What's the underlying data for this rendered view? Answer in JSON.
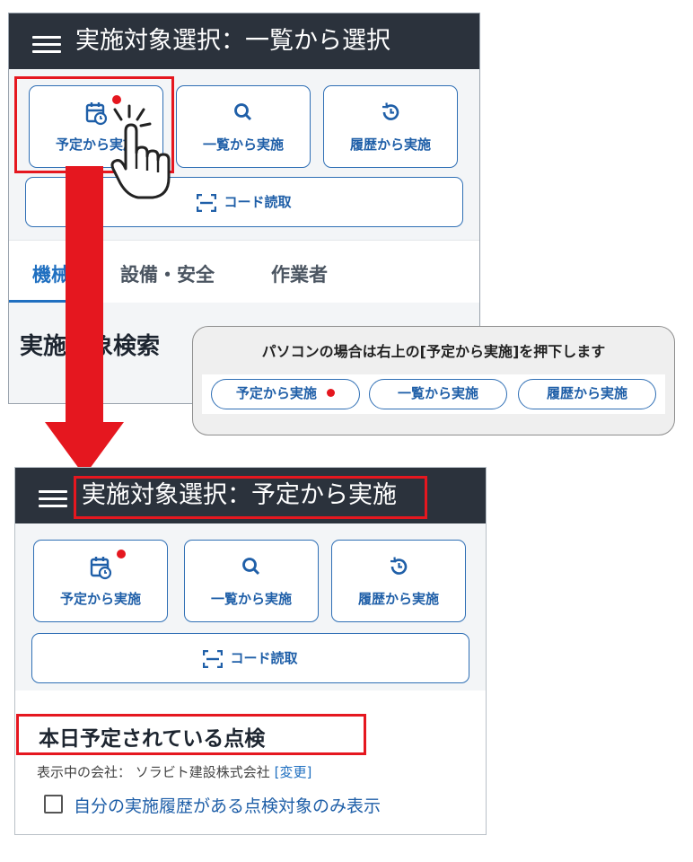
{
  "colors": {
    "header": "#2b323c",
    "accent": "#1f5fa8",
    "highlight": "#e5171f"
  },
  "top_screen": {
    "title": "実施対象選択：一覧から選択",
    "buttons": [
      {
        "label": "予定から実施",
        "icon": "calendar-icon",
        "has_notification_dot": true
      },
      {
        "label": "一覧から実施",
        "icon": "search-icon"
      },
      {
        "label": "履歴から実施",
        "icon": "history-icon"
      }
    ],
    "code_button": "コード読取",
    "tabs": [
      "機械",
      "設備・安全",
      "作業者"
    ],
    "search_title": "実施対象検索"
  },
  "popup": {
    "text": "パソコンの場合は右上の[予定から実施]を押下します",
    "pills": [
      "予定から実施",
      "一覧から実施",
      "履歴から実施"
    ]
  },
  "bottom_screen": {
    "title": "実施対象選択：予定から実施",
    "buttons": [
      {
        "label": "予定から実施",
        "icon": "calendar-icon",
        "has_notification_dot": true
      },
      {
        "label": "一覧から実施",
        "icon": "search-icon"
      },
      {
        "label": "履歴から実施",
        "icon": "history-icon"
      }
    ],
    "code_button": "コード読取",
    "section_title": "本日予定されている点検",
    "company_label": "表示中の会社：",
    "company_name": "ソラビト建設株式会社",
    "company_change": "[変更]",
    "checkbox_label": "自分の実施履歴がある点検対象のみ表示"
  }
}
